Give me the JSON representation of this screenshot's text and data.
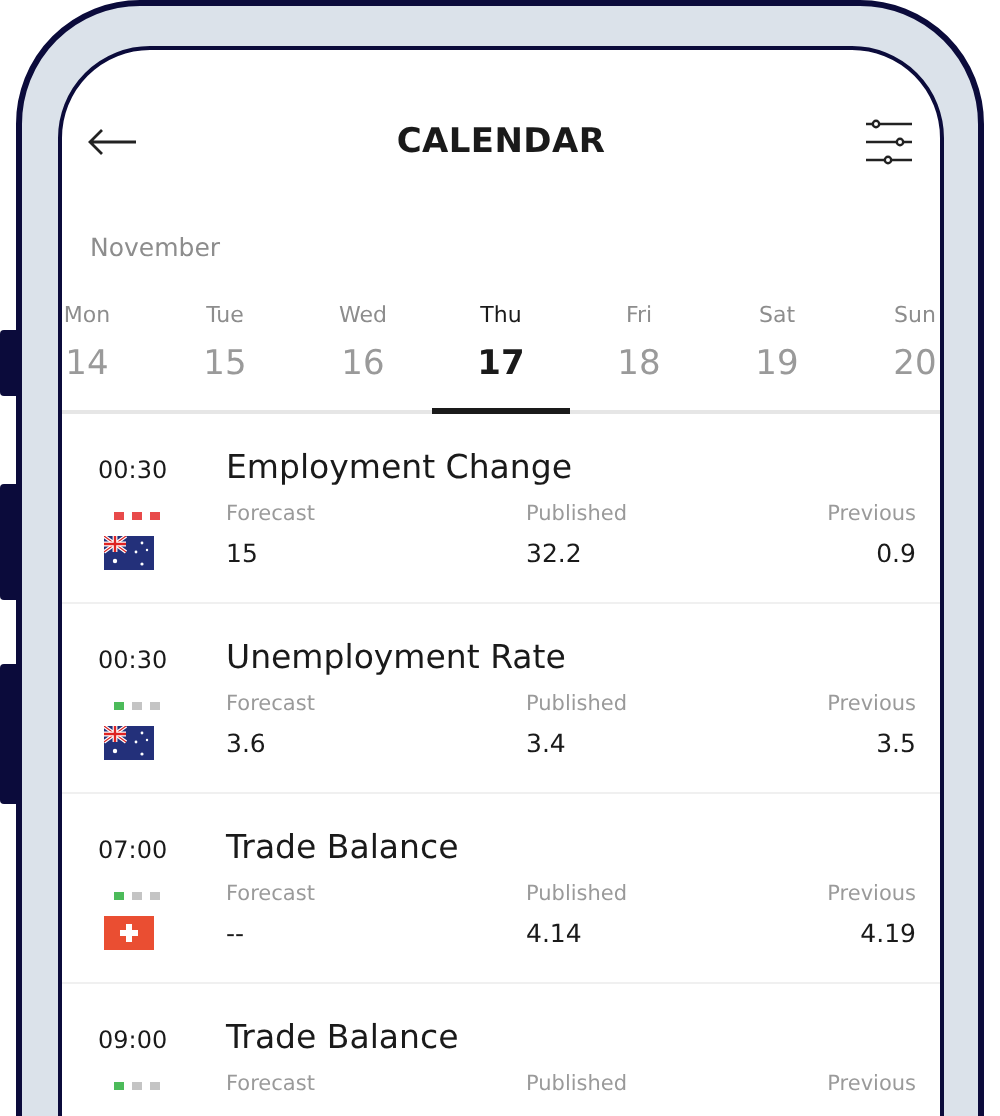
{
  "header": {
    "title": "CALENDAR"
  },
  "month": "November",
  "days": [
    {
      "name": "Mon",
      "date": "14",
      "selected": false
    },
    {
      "name": "Tue",
      "date": "15",
      "selected": false
    },
    {
      "name": "Wed",
      "date": "16",
      "selected": false
    },
    {
      "name": "Thu",
      "date": "17",
      "selected": true
    },
    {
      "name": "Fri",
      "date": "18",
      "selected": false
    },
    {
      "name": "Sat",
      "date": "19",
      "selected": false
    },
    {
      "name": "Sun",
      "date": "20",
      "selected": false
    }
  ],
  "events": [
    {
      "time": "00:30",
      "title": "Employment Change",
      "impact": {
        "kind": "high"
      },
      "flag": {
        "kind": "australia"
      },
      "forecast_label": "Forecast",
      "forecast": "15",
      "published_label": "Published",
      "published": "32.2",
      "previous_label": "Previous",
      "previous": "0.9"
    },
    {
      "time": "00:30",
      "title": "Unemployment Rate",
      "impact": {
        "kind": "low"
      },
      "flag": {
        "kind": "australia"
      },
      "forecast_label": "Forecast",
      "forecast": "3.6",
      "published_label": "Published",
      "published": "3.4",
      "previous_label": "Previous",
      "previous": "3.5"
    },
    {
      "time": "07:00",
      "title": "Trade Balance",
      "impact": {
        "kind": "low"
      },
      "flag": {
        "kind": "switzerland"
      },
      "forecast_label": "Forecast",
      "forecast": "--",
      "published_label": "Published",
      "published": "4.14",
      "previous_label": "Previous",
      "previous": "4.19"
    },
    {
      "time": "09:00",
      "title": "Trade Balance",
      "impact": {
        "kind": "low"
      },
      "forecast_label": "Forecast",
      "published_label": "Published",
      "previous_label": "Previous"
    }
  ]
}
